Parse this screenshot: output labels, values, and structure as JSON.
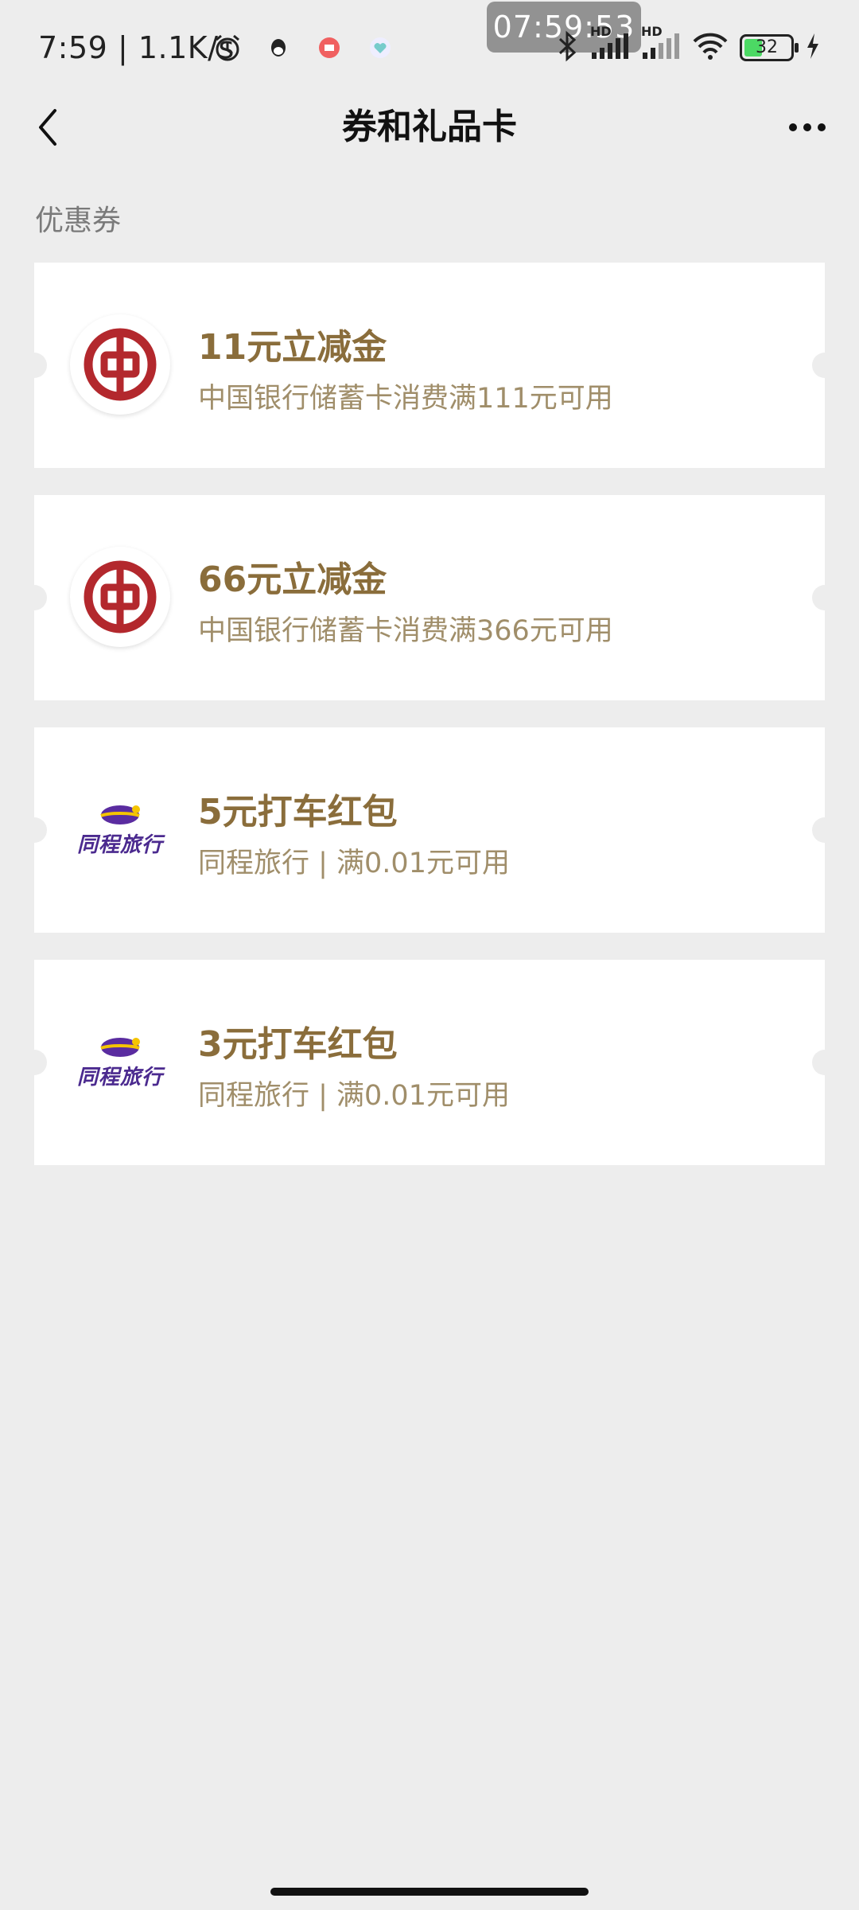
{
  "status_bar": {
    "time": "7:59",
    "net_speed": "1.1K/s",
    "clock_overlay": "07:59:53",
    "hd1": "HD",
    "hd2": "HD",
    "battery": "32"
  },
  "nav": {
    "title": "券和礼品卡",
    "back_icon": "chevron-left-icon",
    "more_icon": "more-horizontal-icon"
  },
  "section": {
    "title": "优惠券"
  },
  "coupons": [
    {
      "name": "11元立减金",
      "desc": "中国银行储蓄卡消费满111元可用",
      "logo": "boc-logo"
    },
    {
      "name": "66元立减金",
      "desc": "中国银行储蓄卡消费满366元可用",
      "logo": "boc-logo"
    },
    {
      "name": "5元打车红包",
      "desc": "同程旅行 | 满0.01元可用",
      "logo": "tongcheng-logo",
      "logo_text": "同程旅行"
    },
    {
      "name": "3元打车红包",
      "desc": "同程旅行 | 满0.01元可用",
      "logo": "tongcheng-logo",
      "logo_text": "同程旅行"
    }
  ],
  "colors": {
    "background": "#ededed",
    "coupon_name": "#8a6d3b",
    "coupon_desc": "#a08e6a",
    "boc_red": "#b3282d",
    "tongcheng_purple": "#4b2a8f",
    "tongcheng_yellow": "#f5c400"
  }
}
